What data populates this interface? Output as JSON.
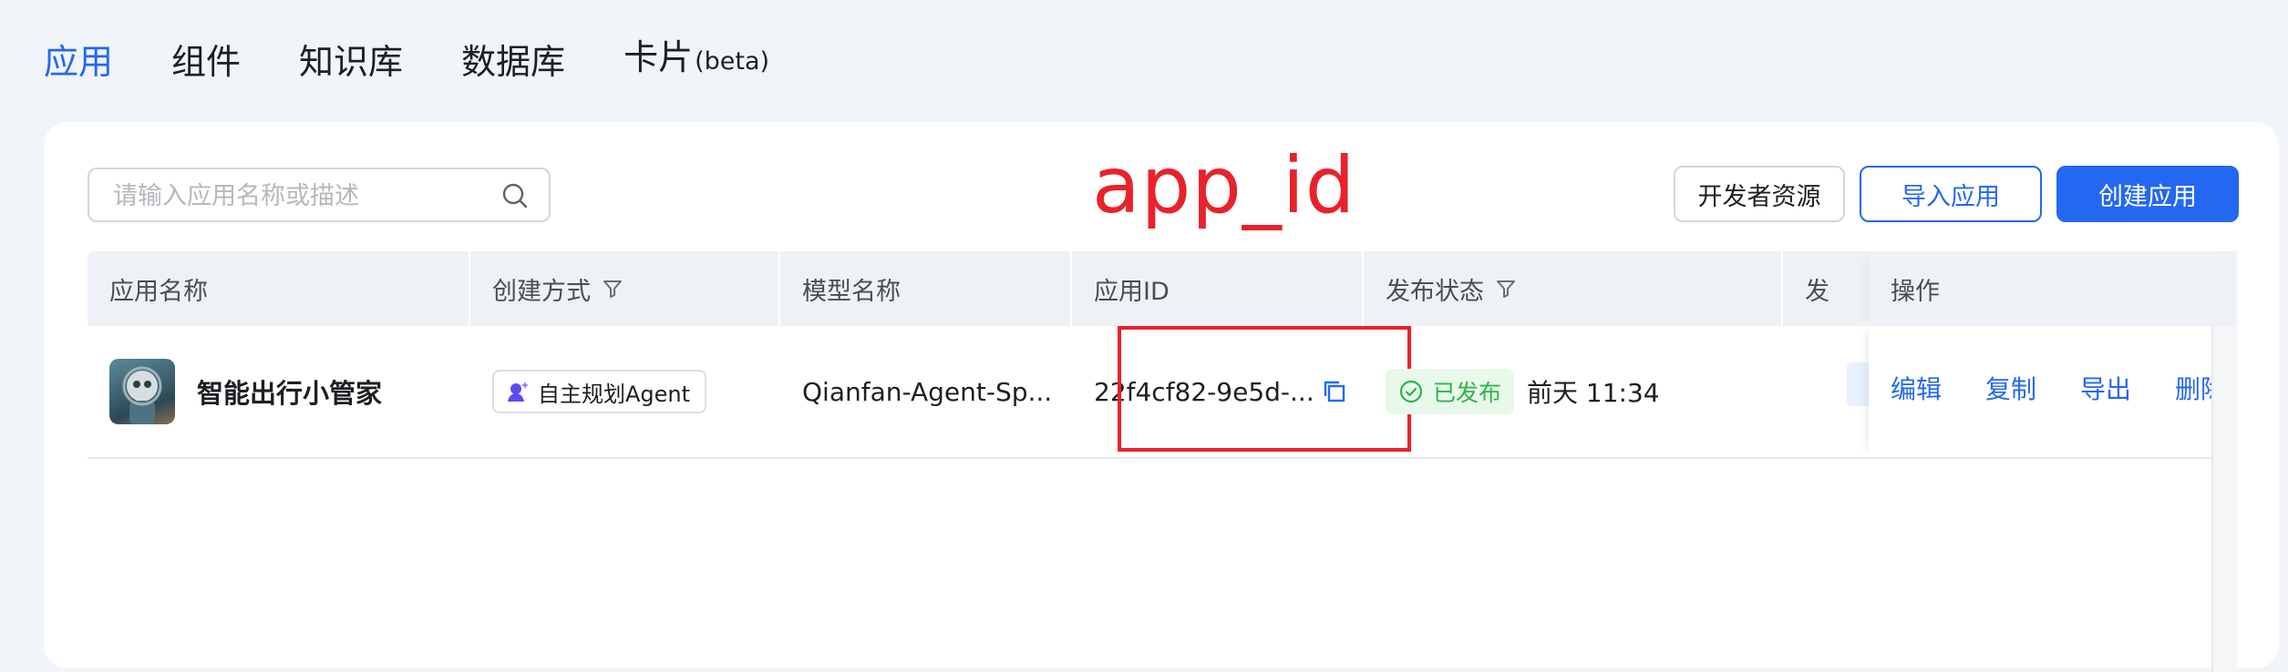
{
  "nav": {
    "tabs": [
      {
        "label": "应用",
        "active": true
      },
      {
        "label": "组件",
        "active": false
      },
      {
        "label": "知识库",
        "active": false
      },
      {
        "label": "数据库",
        "active": false
      },
      {
        "label": "卡片",
        "suffix": "(beta)",
        "active": false
      }
    ]
  },
  "search": {
    "placeholder": "请输入应用名称或描述",
    "value": ""
  },
  "annotation": {
    "text": "app_id",
    "color": "#e8222b"
  },
  "toolbar": {
    "dev_label": "开发者资源",
    "import_label": "导入应用",
    "create_label": "创建应用"
  },
  "table": {
    "columns": [
      "应用名称",
      "创建方式",
      "模型名称",
      "应用ID",
      "发布状态",
      "发",
      "操作"
    ],
    "rows": [
      {
        "name": "智能出行小管家",
        "method": "自主规划Agent",
        "model": "Qianfan-Agent-Sp...",
        "app_id": "22f4cf82-9e5d-...",
        "status": "已发布",
        "time": "前天 11:34",
        "actions": [
          "编辑",
          "复制",
          "导出",
          "删除"
        ]
      }
    ]
  },
  "colors": {
    "accent": "#2468f2",
    "published": "#2fb34a",
    "highlight": "#e8222b"
  }
}
